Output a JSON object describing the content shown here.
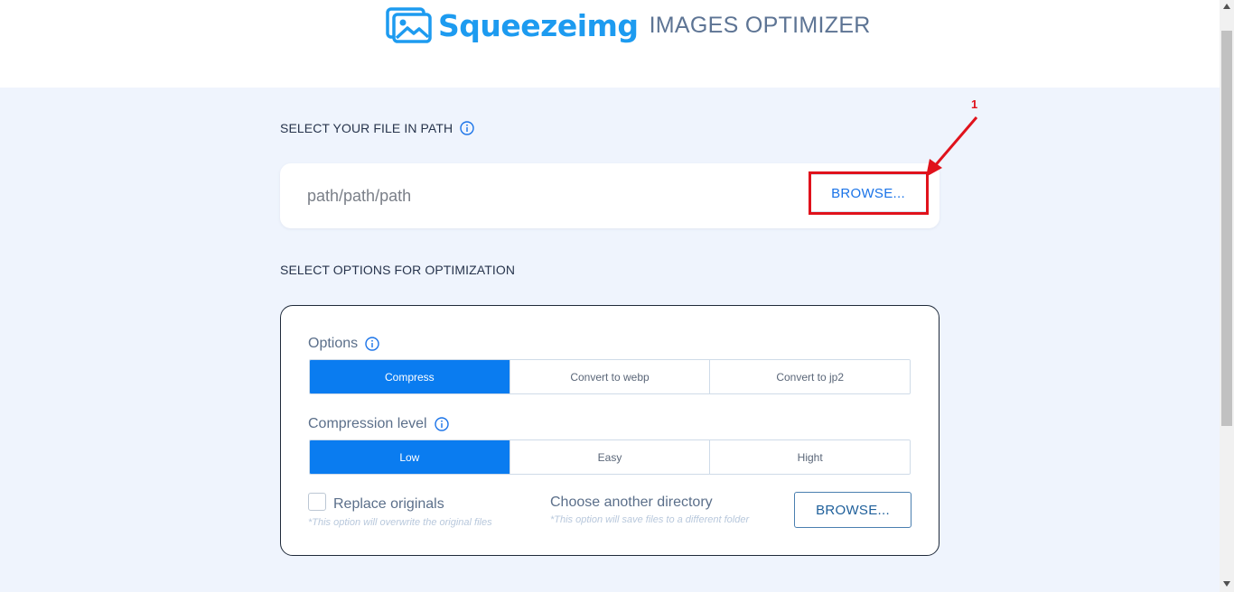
{
  "header": {
    "brand": "Squeezeimg",
    "subtitle": "IMAGES OPTIMIZER",
    "logo_icon": "image-icon",
    "brand_color": "#1d9bf0"
  },
  "file_section": {
    "title": "SELECT YOUR FILE IN PATH",
    "path_value": "path/path/path",
    "browse_label": "BROWSE..."
  },
  "options_section": {
    "title": "SELECT OPTIONS FOR OPTIMIZATION",
    "options_label": "Options",
    "options": [
      "Compress",
      "Convert to webp",
      "Convert to jp2"
    ],
    "options_selected": "Compress",
    "compression_label": "Compression level",
    "levels": [
      "Low",
      "Easy",
      "Hight"
    ],
    "level_selected": "Low",
    "replace_label": "Replace originals",
    "replace_checked": false,
    "replace_hint": "*This option will overwrite the original files",
    "directory_label": "Choose another directory",
    "directory_hint": "*This option will save files to a different folder",
    "browse_label": "BROWSE..."
  },
  "annotation": {
    "number": "1",
    "color": "#e0121c"
  },
  "colors": {
    "accent": "#0a7cf0",
    "background": "#eff4fd"
  }
}
